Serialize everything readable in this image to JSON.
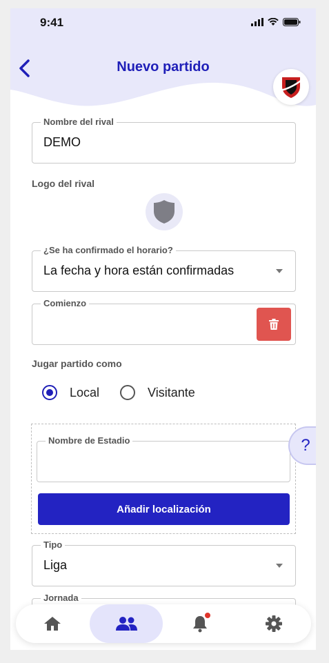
{
  "status_bar": {
    "time": "9:41"
  },
  "header": {
    "title": "Nuevo partido",
    "back_icon": "chevron-left-icon",
    "club_logo": "club-shield-logo"
  },
  "form": {
    "rival_name": {
      "label": "Nombre del rival",
      "value": "DEMO"
    },
    "rival_logo": {
      "label": "Logo del rival",
      "icon": "shield-icon"
    },
    "schedule_confirmed": {
      "label": "¿Se ha confirmado el horario?",
      "value": "La fecha y hora están confirmadas"
    },
    "start": {
      "label": "Comienzo",
      "value": ""
    },
    "play_as": {
      "label": "Jugar partido como",
      "options": [
        {
          "label": "Local",
          "checked": true
        },
        {
          "label": "Visitante",
          "checked": false
        }
      ]
    },
    "stadium": {
      "label": "Nombre de Estadio",
      "value": ""
    },
    "add_location_label": "Añadir localización",
    "type": {
      "label": "Tipo",
      "value": "Liga"
    },
    "matchday": {
      "label": "Jornada"
    }
  },
  "help_label": "?",
  "colors": {
    "accent": "#2323c2",
    "title": "#1f1fb8",
    "danger": "#e05550",
    "header_bg": "#e8e8fa"
  },
  "bottom_nav": [
    "home-icon",
    "team-icon",
    "bell-icon",
    "gear-icon"
  ]
}
